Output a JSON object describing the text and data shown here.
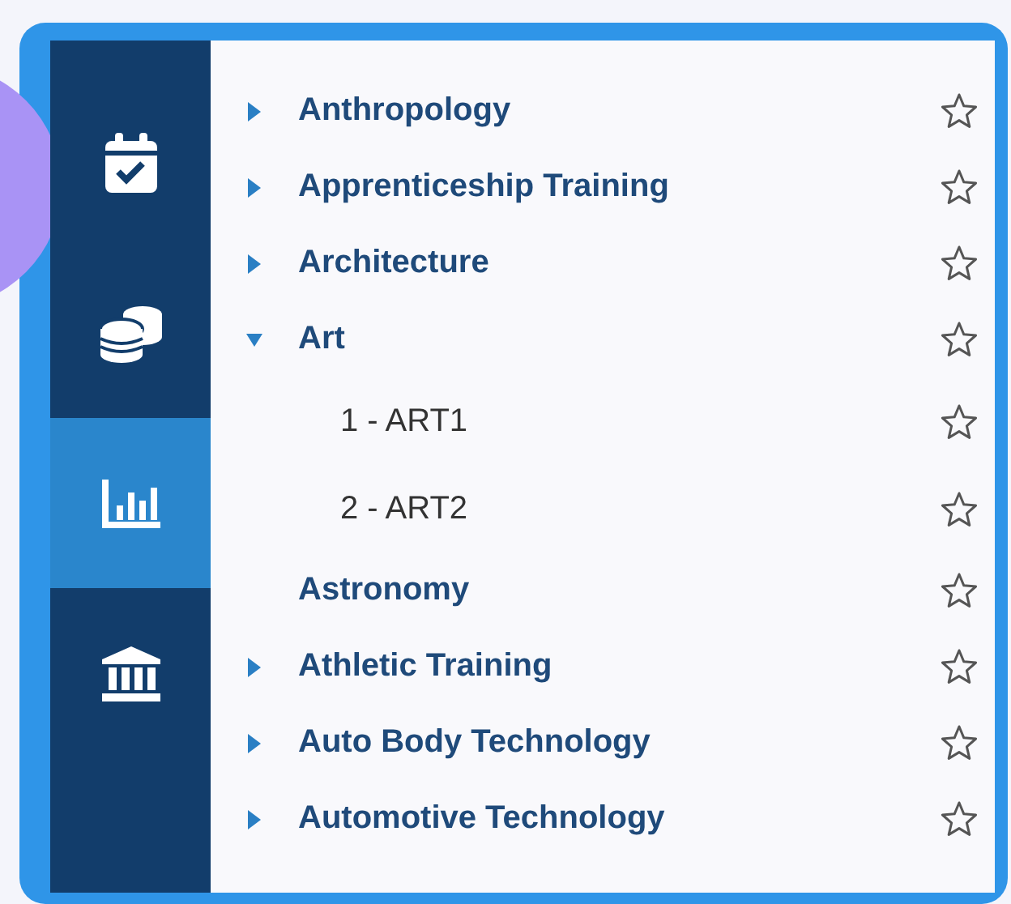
{
  "sidebar": {
    "items": [
      {
        "selected": false
      },
      {
        "selected": false
      },
      {
        "selected": true
      },
      {
        "selected": false
      }
    ]
  },
  "tree": [
    {
      "label": "Anthropology",
      "expanded": false,
      "starred": false
    },
    {
      "label": "Apprenticeship Training",
      "expanded": false,
      "starred": false
    },
    {
      "label": "Architecture",
      "expanded": false,
      "starred": false
    },
    {
      "label": "Art",
      "expanded": true,
      "starred": false,
      "children": [
        {
          "label": "1 - ART1",
          "starred": false
        },
        {
          "label": "2 - ART2",
          "starred": false
        }
      ]
    },
    {
      "label": "Astronomy",
      "starred": false
    },
    {
      "label": "Athletic Training",
      "expanded": false,
      "starred": false
    },
    {
      "label": "Auto Body Technology",
      "expanded": false,
      "starred": false
    },
    {
      "label": "Automotive Technology",
      "expanded": false,
      "starred": false
    }
  ]
}
